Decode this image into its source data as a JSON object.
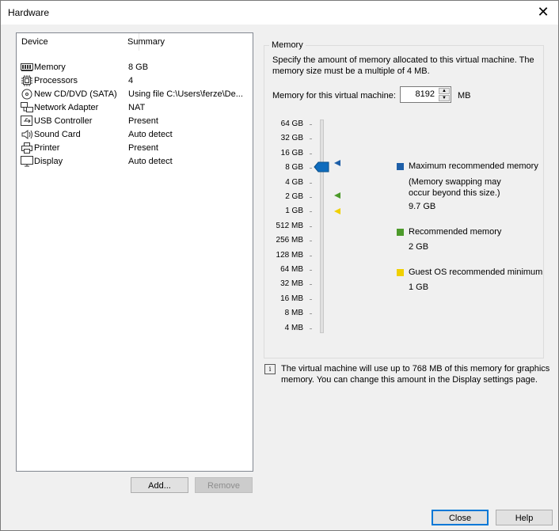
{
  "window": {
    "title": "Hardware"
  },
  "device_list": {
    "columns": [
      "Device",
      "Summary"
    ],
    "rows": [
      {
        "icon": "memory-icon",
        "device": "Memory",
        "summary": "8 GB"
      },
      {
        "icon": "processor-icon",
        "device": "Processors",
        "summary": "4"
      },
      {
        "icon": "cd-dvd-icon",
        "device": "New CD/DVD (SATA)",
        "summary": "Using file C:\\Users\\ferze\\De..."
      },
      {
        "icon": "network-adapter-icon",
        "device": "Network Adapter",
        "summary": "NAT"
      },
      {
        "icon": "usb-icon",
        "device": "USB Controller",
        "summary": "Present"
      },
      {
        "icon": "speaker-icon",
        "device": "Sound Card",
        "summary": "Auto detect"
      },
      {
        "icon": "printer-icon",
        "device": "Printer",
        "summary": "Present"
      },
      {
        "icon": "monitor-icon",
        "device": "Display",
        "summary": "Auto detect"
      }
    ]
  },
  "buttons": {
    "add": "Add...",
    "remove": "Remove",
    "close": "Close",
    "help": "Help"
  },
  "memory": {
    "group_title": "Memory",
    "description": "Specify the amount of memory allocated to this virtual machine. The memory size must be a multiple of 4 MB.",
    "field_label": "Memory for this virtual machine:",
    "value": "8192",
    "unit": "MB",
    "slider_ticks": [
      "64 GB",
      "32 GB",
      "16 GB",
      "8 GB",
      "4 GB",
      "2 GB",
      "1 GB",
      "512 MB",
      "256 MB",
      "128 MB",
      "64 MB",
      "32 MB",
      "16 MB",
      "8 MB",
      "4 MB"
    ],
    "slider_selected": "8 GB",
    "legend": {
      "max_label": "Maximum recommended memory",
      "max_note": "(Memory swapping may occur beyond this size.)",
      "max_value": "9.7 GB",
      "rec_label": "Recommended memory",
      "rec_value": "2 GB",
      "min_label": "Guest OS recommended minimum",
      "min_value": "1 GB"
    },
    "info": "The virtual machine will use up to 768 MB of this memory for graphics memory. You can change this amount in the Display settings page."
  },
  "colors": {
    "max": "#1e5fa8",
    "rec": "#4c9a2a",
    "min": "#f0d000",
    "thumb": "#0f6cbd"
  }
}
